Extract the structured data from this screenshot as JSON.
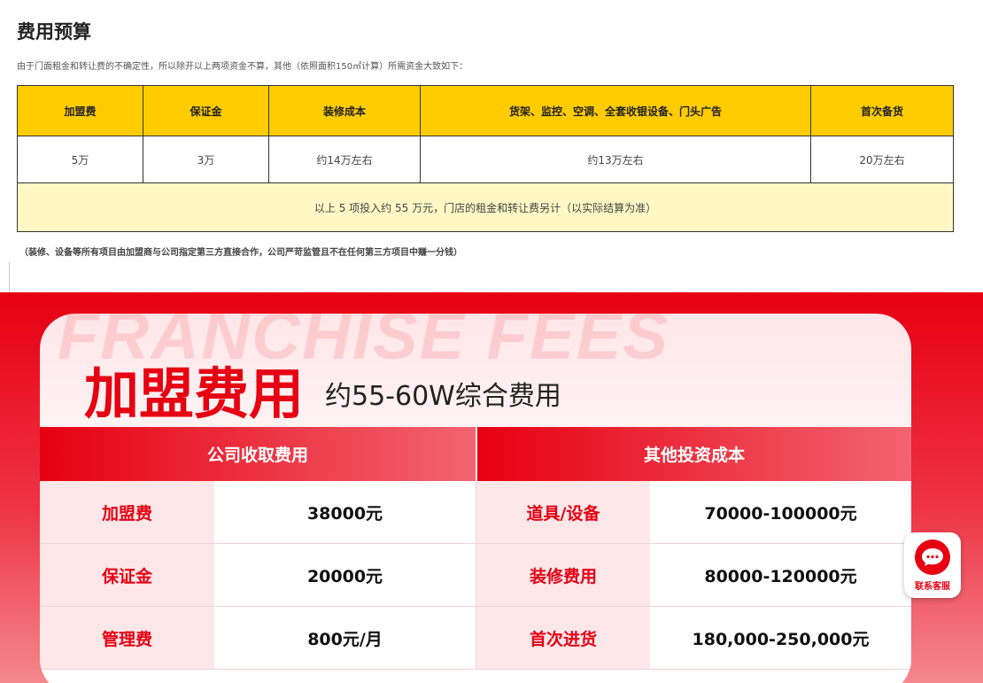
{
  "budget": {
    "title": "费用预算",
    "intro": "由于门面租金和转让费的不确定性，所以除开以上两项资金不算，其他（依照面积150㎡计算）所需资金大致如下：",
    "headers": [
      "加盟费",
      "保证金",
      "装修成本",
      "货架、监控、空调、全套收银设备、门头广告",
      "首次备货"
    ],
    "values": [
      "5万",
      "3万",
      "约14万左右",
      "约13万左右",
      "20万左右"
    ],
    "summary": "以上 5 项投入约 55 万元，门店的租金和转让费另计（以实际结算为准）",
    "footnote": "（装修、设备等所有项目由加盟商与公司指定第三方直接合作，公司严苛监管且不在任何第三方项目中赚一分钱）"
  },
  "fees": {
    "watermark": "FRANCHISE FEES",
    "title": "加盟费用",
    "subtitle": "约55-60W综合费用",
    "company_header": "公司收取费用",
    "other_header": "其他投资成本",
    "rows": [
      {
        "left_label": "加盟费",
        "left_value": "38000元",
        "right_label": "道具/设备",
        "right_value": "70000-100000元"
      },
      {
        "left_label": "保证金",
        "left_value": "20000元",
        "right_label": "装修费用",
        "right_value": "80000-120000元"
      },
      {
        "left_label": "管理费",
        "left_value": "800元/月",
        "right_label": "首次进货",
        "right_value": "180,000-250,000元"
      }
    ]
  },
  "service": {
    "label": "联系客服",
    "icon": "chat-bubble-icon",
    "color": "#e60012"
  }
}
